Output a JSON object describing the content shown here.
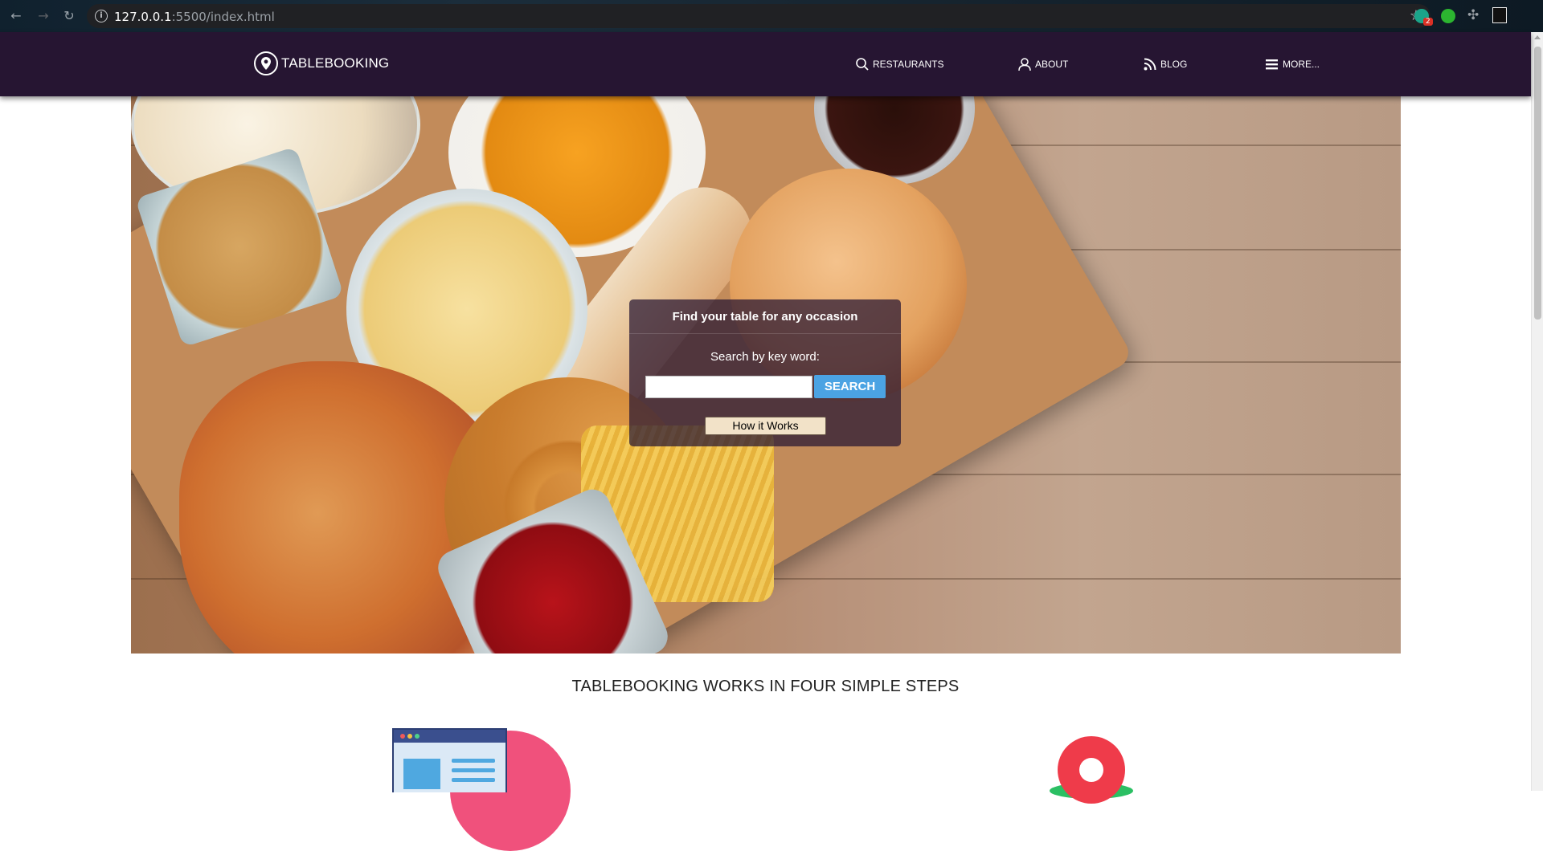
{
  "browser": {
    "url_host": "127.0.0.1",
    "url_path": ":5500/index.html",
    "extension_badge": "2"
  },
  "navbar": {
    "brand": "TABLEBOOKING",
    "links": [
      {
        "label": "RESTAURANTS",
        "icon": "search-icon"
      },
      {
        "label": "ABOUT",
        "icon": "user-icon"
      },
      {
        "label": "BLOG",
        "icon": "rss-icon"
      },
      {
        "label": "MORE...",
        "icon": "menu-icon"
      }
    ]
  },
  "search_panel": {
    "title": "Find your table for any occasion",
    "label": "Search by key word:",
    "input_value": "",
    "search_button": "SEARCH",
    "how_button": "How it Works"
  },
  "steps": {
    "title": "TABLEBOOKING WORKS IN FOUR SIMPLE STEPS"
  },
  "colors": {
    "navbar_bg": "#261532",
    "search_button": "#4ba3e3",
    "how_button": "#f2e2c8",
    "pin_red": "#ef3b4a"
  }
}
